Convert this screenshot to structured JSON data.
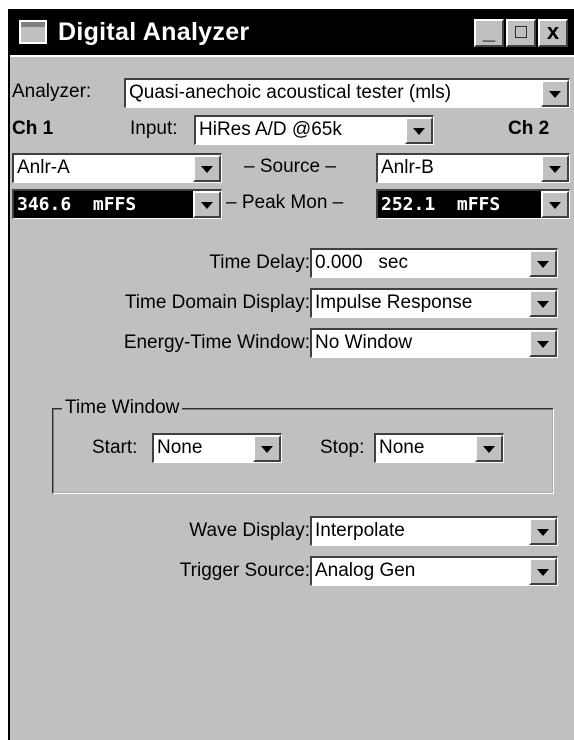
{
  "window": {
    "title": "Digital Analyzer",
    "minimize": "_",
    "maximize": "□",
    "close": "x"
  },
  "analyzer": {
    "label": "Analyzer:",
    "value": "Quasi-anechoic acoustical tester (mls)"
  },
  "channels": {
    "ch1": "Ch 1",
    "ch2": "Ch 2",
    "input_label": "Input:",
    "input_value": "HiRes A/D @65k"
  },
  "source": {
    "label": "– Source –",
    "left": "Anlr-A",
    "right": "Anlr-B"
  },
  "peak_mon": {
    "label": "– Peak Mon –",
    "left": "346.6  mFFS",
    "right": "252.1  mFFS"
  },
  "time_delay": {
    "label": "Time Delay:",
    "value": "0.000   sec"
  },
  "time_domain": {
    "label": "Time Domain Display:",
    "value": "Impulse Response"
  },
  "energy_window": {
    "label": "Energy-Time Window:",
    "value": "No Window"
  },
  "time_window": {
    "title": "Time Window",
    "start_label": "Start:",
    "start_value": "None",
    "stop_label": "Stop:",
    "stop_value": "None"
  },
  "wave_display": {
    "label": "Wave Display:",
    "value": "Interpolate"
  },
  "trigger_source": {
    "label": "Trigger Source:",
    "value": "Analog Gen"
  },
  "colors": {
    "titlebar": "#000000",
    "panel": "#c0c0c0",
    "meter_bg": "#000000"
  }
}
